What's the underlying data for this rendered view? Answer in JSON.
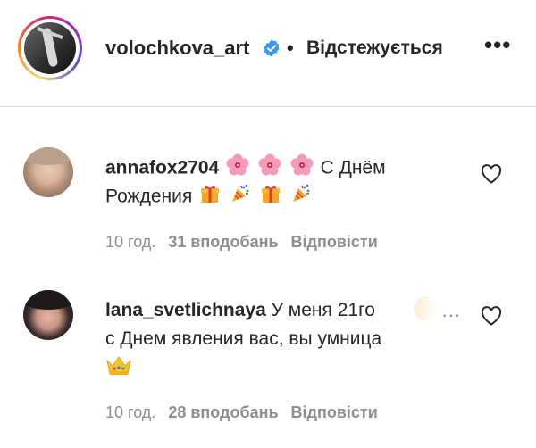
{
  "post_header": {
    "username": "volochkova_art",
    "separator": "•",
    "follow_status": "Відстежується",
    "more_label": "•••"
  },
  "comments": [
    {
      "username": "annafox2704",
      "line1_tail": "С Днём",
      "line2": "Рождения",
      "emoji_line1": [
        "hibiscus",
        "hibiscus",
        "hibiscus"
      ],
      "emoji_line2": [
        "gift",
        "confetti",
        "gift",
        "confetti"
      ],
      "time": "10 год.",
      "likes": "31 вподобань",
      "reply": "Відповісти"
    },
    {
      "username": "lana_svetlichnaya",
      "line1_tail": "У меня 21го",
      "line2": "с Днем явления вас, вы умница",
      "emoji_line3": [
        "crown"
      ],
      "truncation": "...",
      "time": "10 год.",
      "likes": "28 вподобань",
      "reply": "Відповісти"
    }
  ],
  "colors": {
    "text_primary": "#262626",
    "text_secondary": "#8e8e8e",
    "verified_blue": "#3897f0",
    "divider": "#dbdbdb"
  }
}
